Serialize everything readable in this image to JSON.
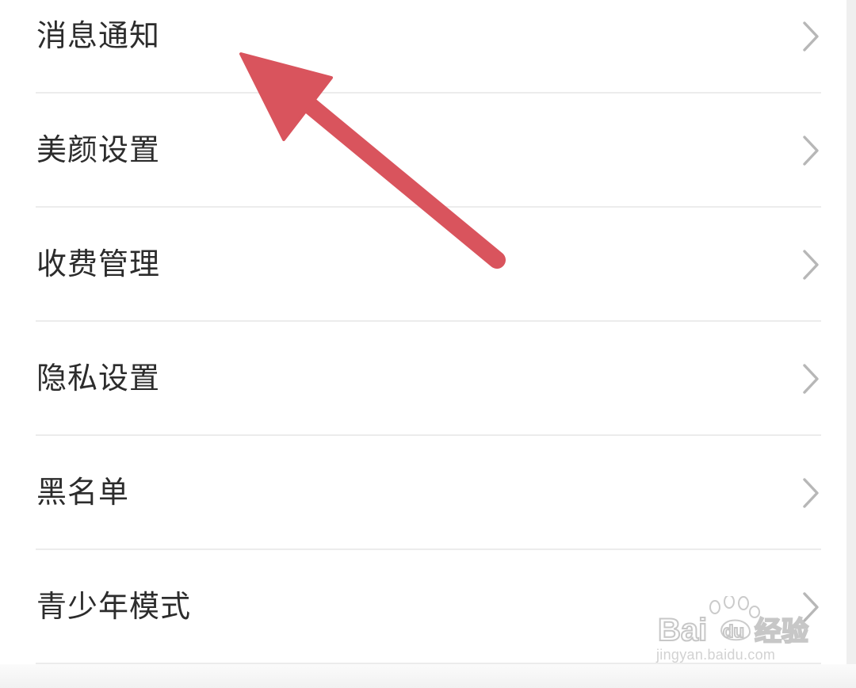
{
  "settings": {
    "items": [
      {
        "label": "消息通知"
      },
      {
        "label": "美颜设置"
      },
      {
        "label": "收费管理"
      },
      {
        "label": "隐私设置"
      },
      {
        "label": "黑名单"
      },
      {
        "label": "青少年模式"
      }
    ]
  },
  "annotation": {
    "arrow_color": "#d9545d",
    "target": "消息通知"
  },
  "watermark": {
    "logo_text": "Baidu经验",
    "url": "jingyan.baidu.com"
  },
  "colors": {
    "label": "#2c2c2c",
    "chevron": "#b7b7b7",
    "divider": "#ececec",
    "background": "#ffffff"
  }
}
